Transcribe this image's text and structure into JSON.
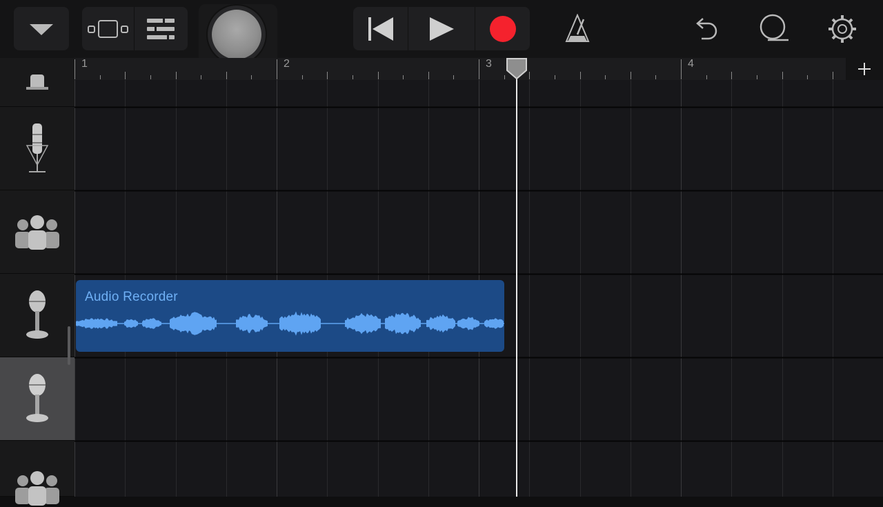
{
  "toolbar": {
    "buttons": [
      {
        "id": "browser-dropdown",
        "icon": "chevron-down-icon"
      },
      {
        "id": "tracks-view",
        "icon": "tracks-view-icon"
      },
      {
        "id": "smart-controls",
        "icon": "smart-controls-icon"
      },
      {
        "id": "master-volume",
        "icon": "knob-icon"
      },
      {
        "id": "go-to-beginning",
        "icon": "skip-back-icon"
      },
      {
        "id": "play",
        "icon": "play-icon"
      },
      {
        "id": "record",
        "icon": "record-icon"
      },
      {
        "id": "metronome",
        "icon": "metronome-icon"
      },
      {
        "id": "undo",
        "icon": "undo-icon"
      },
      {
        "id": "loop",
        "icon": "loop-icon"
      },
      {
        "id": "settings",
        "icon": "gear-icon"
      }
    ],
    "record_color": "#f5222d"
  },
  "ruler": {
    "bars": [
      "1",
      "2",
      "3",
      "4"
    ],
    "add_label": "+"
  },
  "tracks": [
    {
      "icon": "microphone-icon",
      "selected": false
    },
    {
      "icon": "condenser-mic-icon",
      "selected": false
    },
    {
      "icon": "group-icon",
      "selected": false
    },
    {
      "icon": "microphone-icon",
      "selected": false
    },
    {
      "icon": "microphone-icon",
      "selected": true
    },
    {
      "icon": "group-icon",
      "selected": false
    }
  ],
  "region": {
    "name": "Audio Recorder",
    "color": "#1c4a86",
    "waveform_color": "#5fa4f2"
  },
  "playhead": {
    "bar_position": 3.2
  }
}
